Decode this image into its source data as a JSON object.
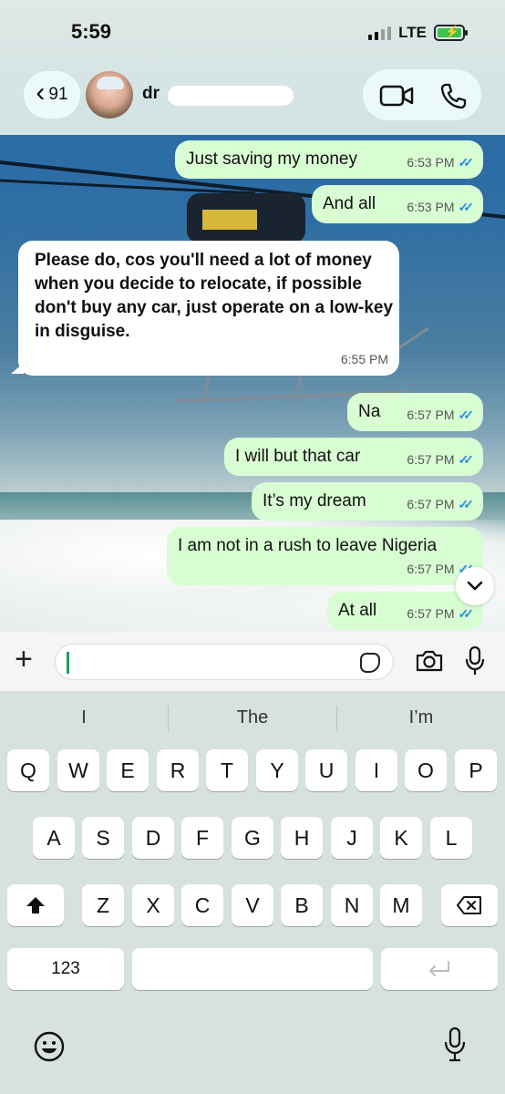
{
  "status": {
    "time": "5:59",
    "network": "LTE"
  },
  "header": {
    "back_count": "91",
    "contact_name_visible": "dr"
  },
  "messages": [
    {
      "dir": "out",
      "text": "Just saving my money",
      "time": "6:53 PM"
    },
    {
      "dir": "out",
      "text": "And all",
      "time": "6:53 PM"
    },
    {
      "dir": "in",
      "text": "Please do, cos you'll need a lot of money when you decide to relocate, if possible don't buy any car, just operate on a low-key in disguise.",
      "time": "6:55 PM"
    },
    {
      "dir": "out",
      "text": "Na",
      "time": "6:57 PM"
    },
    {
      "dir": "out",
      "text": "I will but that car",
      "time": "6:57 PM"
    },
    {
      "dir": "out",
      "text": "It’s my dream",
      "time": "6:57 PM"
    },
    {
      "dir": "out",
      "text": "I am not in a rush to leave Nigeria",
      "time": "6:57 PM"
    },
    {
      "dir": "out",
      "text": "At all",
      "time": "6:57 PM"
    }
  ],
  "keyboard": {
    "suggestions": [
      "I",
      "The",
      "I’m"
    ],
    "row1": [
      "Q",
      "W",
      "E",
      "R",
      "T",
      "Y",
      "U",
      "I",
      "O",
      "P"
    ],
    "row2": [
      "A",
      "S",
      "D",
      "F",
      "G",
      "H",
      "J",
      "K",
      "L"
    ],
    "row3": [
      "Z",
      "X",
      "C",
      "V",
      "B",
      "N",
      "M"
    ],
    "numbers_key": "123"
  },
  "icons": {
    "back": "chevron-left-icon",
    "video": "video-camera-icon",
    "phone": "phone-icon",
    "plus": "plus-icon",
    "sticker": "sticker-icon",
    "camera": "camera-icon",
    "mic": "microphone-icon",
    "shift": "shift-icon",
    "delete": "backspace-icon",
    "return": "return-icon",
    "emoji": "emoji-icon",
    "read_receipt": "double-check-icon"
  },
  "colors": {
    "outgoing_bubble": "#d9fdd3",
    "incoming_bubble": "#ffffff",
    "read_tick": "#2a8fe0",
    "caret": "#1aa35a"
  }
}
